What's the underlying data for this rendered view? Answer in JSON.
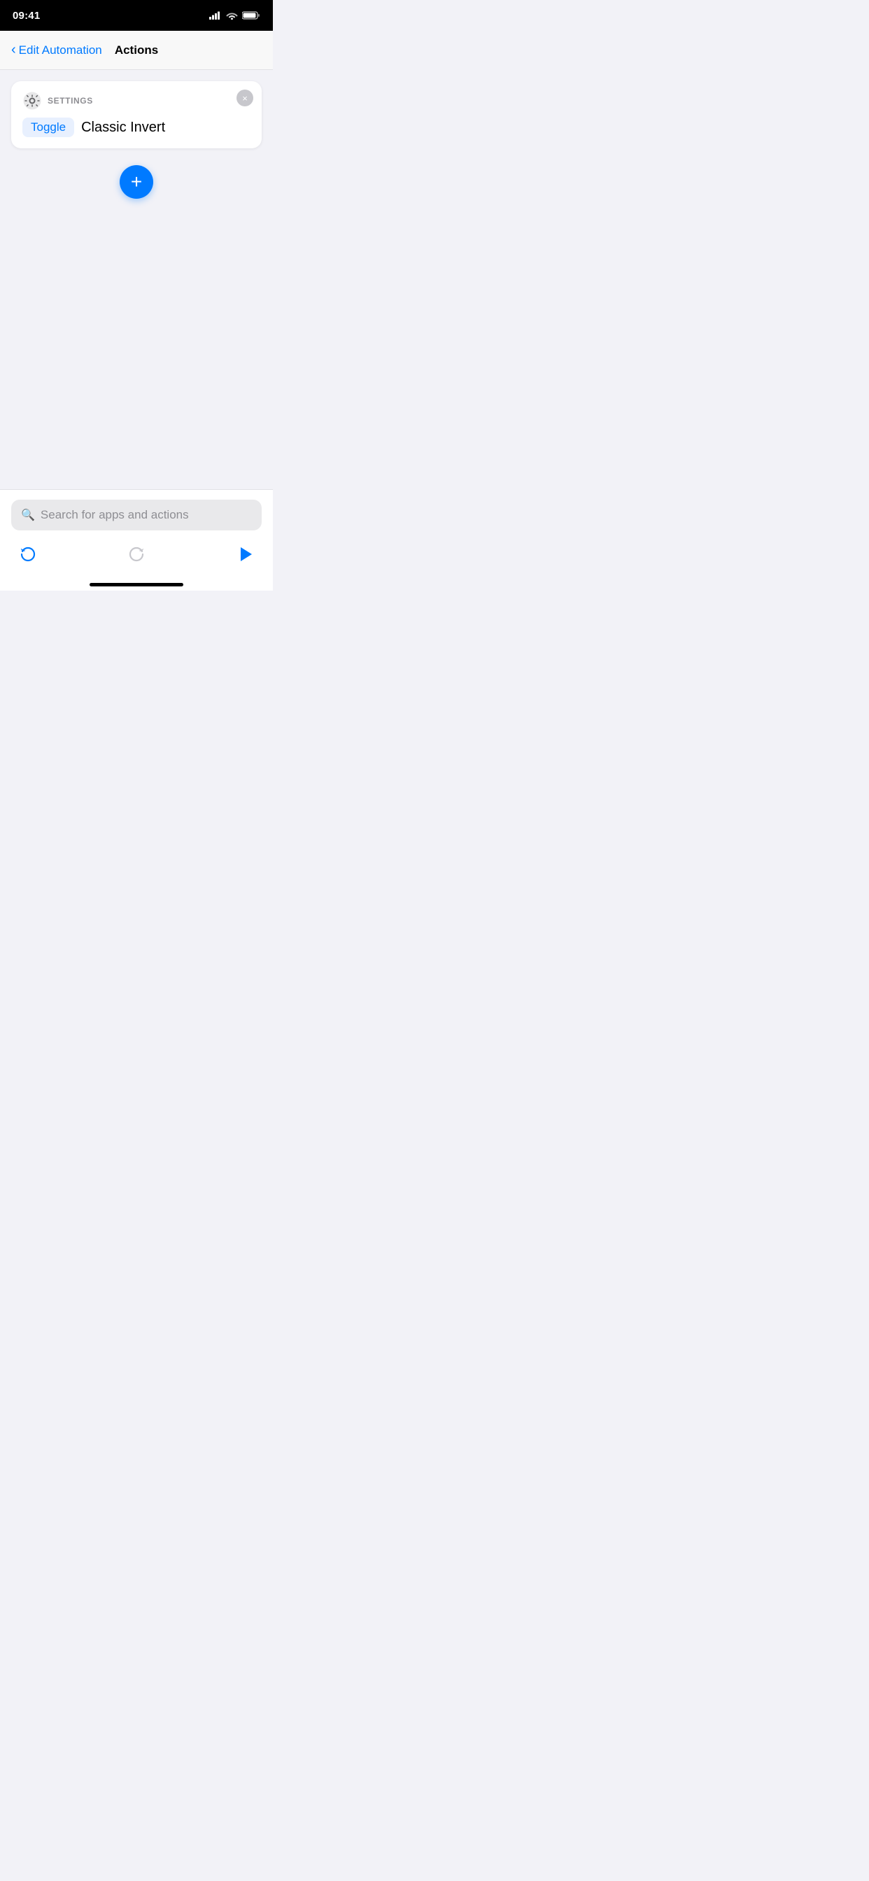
{
  "statusBar": {
    "time": "09:41",
    "signal": "signal-icon",
    "wifi": "wifi-icon",
    "battery": "battery-icon"
  },
  "nav": {
    "backLabel": "Edit Automation",
    "title": "Actions"
  },
  "actionCard": {
    "headerIcon": "settings-icon",
    "headerLabel": "SETTINGS",
    "toggleLabel": "Toggle",
    "actionText": "Classic Invert",
    "closeLabel": "×"
  },
  "addButton": {
    "label": "+"
  },
  "bottomPanel": {
    "searchPlaceholder": "Search for apps and actions",
    "undoLabel": "undo",
    "redoLabel": "redo",
    "playLabel": "play"
  }
}
